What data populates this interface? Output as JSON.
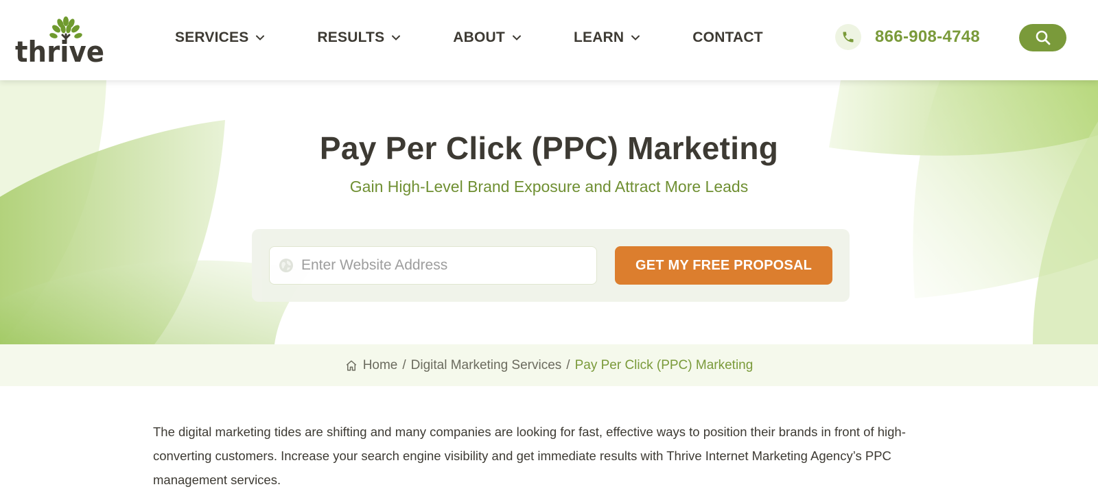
{
  "brand": {
    "logo_text": "thrive",
    "accent": "#7a9a3a",
    "cta_color": "#db7a28",
    "dark_text": "#3d3a33"
  },
  "nav": {
    "items": [
      {
        "label": "SERVICES",
        "dropdown": true
      },
      {
        "label": "RESULTS",
        "dropdown": true
      },
      {
        "label": "ABOUT",
        "dropdown": true
      },
      {
        "label": "LEARN",
        "dropdown": true
      },
      {
        "label": "CONTACT",
        "dropdown": false
      }
    ],
    "phone": "866-908-4748",
    "phone_icon": "phone-icon",
    "search_icon": "search-icon"
  },
  "hero": {
    "title": "Pay Per Click (PPC) Marketing",
    "subtitle": "Gain High-Level Brand Exposure and Attract More Leads",
    "input_placeholder": "Enter Website Address",
    "cta_label": "GET MY FREE PROPOSAL"
  },
  "breadcrumb": {
    "home": "Home",
    "sep": "/",
    "section": "Digital Marketing Services",
    "current": "Pay Per Click (PPC) Marketing"
  },
  "content": {
    "intro": "The digital marketing tides are shifting and many companies are looking for fast, effective ways to position their brands in front of high-converting customers. Increase your search engine visibility and get immediate results with Thrive Internet Marketing Agency’s PPC management services."
  }
}
